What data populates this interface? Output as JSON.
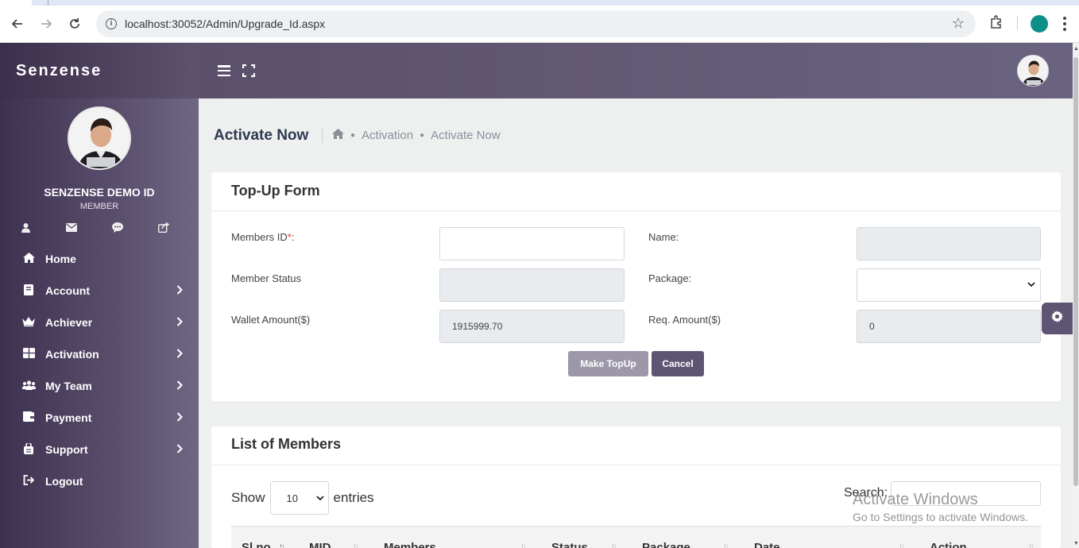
{
  "browser": {
    "url": "localhost:30052/Admin/Upgrade_Id.aspx"
  },
  "sidebar": {
    "brand": "Senzense",
    "user_name": "SENZENSE DEMO ID",
    "user_role": "MEMBER",
    "items": [
      {
        "label": "Home",
        "icon": "home-icon",
        "has_children": false
      },
      {
        "label": "Account",
        "icon": "book-icon",
        "has_children": true
      },
      {
        "label": "Achiever",
        "icon": "crown-icon",
        "has_children": true
      },
      {
        "label": "Activation",
        "icon": "grid-icon",
        "has_children": true
      },
      {
        "label": "My Team",
        "icon": "users-icon",
        "has_children": true
      },
      {
        "label": "Payment",
        "icon": "wallet-icon",
        "has_children": true
      },
      {
        "label": "Support",
        "icon": "support-icon",
        "has_children": true
      },
      {
        "label": "Logout",
        "icon": "logout-icon",
        "has_children": false
      }
    ]
  },
  "page": {
    "title": "Activate Now",
    "breadcrumb": [
      "Activation",
      "Activate Now"
    ]
  },
  "topup_form": {
    "title": "Top-Up Form",
    "members_id_label": "Members ID",
    "required_mark": "*",
    "members_id_suffix": ":",
    "members_id_value": "",
    "name_label": "Name:",
    "name_value": "",
    "member_status_label": "Member Status",
    "member_status_value": "",
    "package_label": "Package:",
    "package_value": "",
    "wallet_amount_label": "Wallet Amount($)",
    "wallet_amount_value": "1915999.70",
    "req_amount_label": "Req. Amount($)",
    "req_amount_value": "0",
    "make_topup_label": "Make TopUp",
    "cancel_label": "Cancel"
  },
  "members_list": {
    "title": "List of Members",
    "show_label": "Show",
    "page_size": "10",
    "entries_label": "entries",
    "search_label": "Search:",
    "columns": [
      "Sl.no.",
      "MID",
      "Members",
      "Status",
      "Package",
      "Date",
      "Action"
    ]
  },
  "watermark": {
    "line1": "Activate Windows",
    "line2": "Go to Settings to activate Windows."
  },
  "colors": {
    "sidebar_dark": "#3e3150",
    "header": "#5b506b",
    "button_primary": "#9d97aa",
    "button_cancel": "#5e5574",
    "accent_profile": "#0e8f8a"
  }
}
